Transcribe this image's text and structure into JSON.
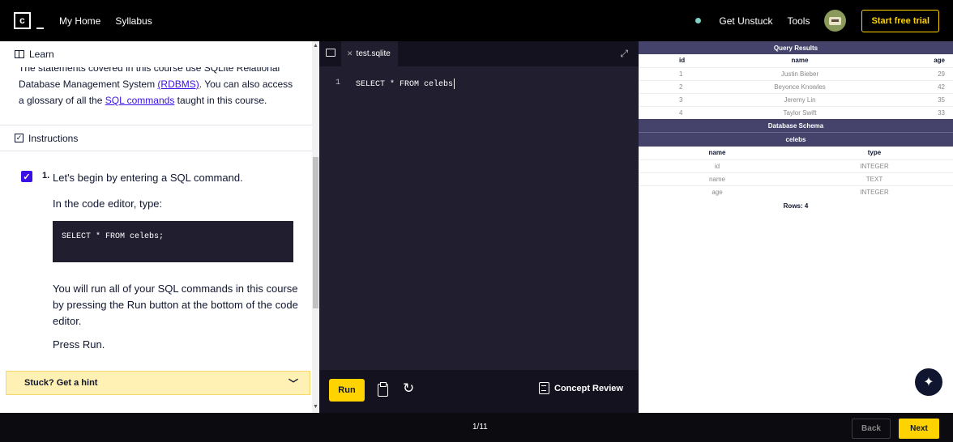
{
  "nav": {
    "logo_letter": "c",
    "home": "My Home",
    "syllabus": "Syllabus",
    "get_unstuck": "Get Unstuck",
    "tools": "Tools",
    "trial": "Start free trial"
  },
  "learn": {
    "header": "Learn",
    "text_before_rdbms": "The statements covered in this course use SQLite Relational Database Management System ",
    "rdbms_link": "(RDBMS)",
    "text_mid": ". You can also access a glossary of all the ",
    "sql_link": "SQL commands",
    "text_end": " taught in this course."
  },
  "instructions": {
    "header": "Instructions",
    "step_number": "1.",
    "step_text": "Let's begin by entering a SQL command.",
    "editor_type": "In the code editor, type:",
    "code": "SELECT * FROM celebs;",
    "run_text": "You will run all of your SQL commands in this course by pressing the Run button at the bottom of the code editor.",
    "press_run": "Press Run.",
    "hint": "Stuck? Get a hint"
  },
  "editor": {
    "filename": "test.sqlite",
    "line_number": "1",
    "code": "SELECT * FROM celebs",
    "run": "Run",
    "concept_review": "Concept Review"
  },
  "results": {
    "query_title": "Query Results",
    "columns": [
      "id",
      "name",
      "age"
    ],
    "rows": [
      [
        "1",
        "Justin Bieber",
        "29"
      ],
      [
        "2",
        "Beyonce Knowles",
        "42"
      ],
      [
        "3",
        "Jeremy Lin",
        "35"
      ],
      [
        "4",
        "Taylor Swift",
        "33"
      ]
    ],
    "schema_title": "Database Schema",
    "table_name": "celebs",
    "schema_columns": [
      "name",
      "type"
    ],
    "schema_rows": [
      [
        "id",
        "INTEGER"
      ],
      [
        "name",
        "TEXT"
      ],
      [
        "age",
        "INTEGER"
      ]
    ],
    "rows_count": "Rows: 4"
  },
  "footer": {
    "progress": "1/11",
    "back": "Back",
    "next": "Next"
  },
  "colors": {
    "accent_yellow": "#ffd300",
    "link_blue": "#3a10e5",
    "schema_header": "#45436b",
    "editor_bg": "#211e2f"
  }
}
